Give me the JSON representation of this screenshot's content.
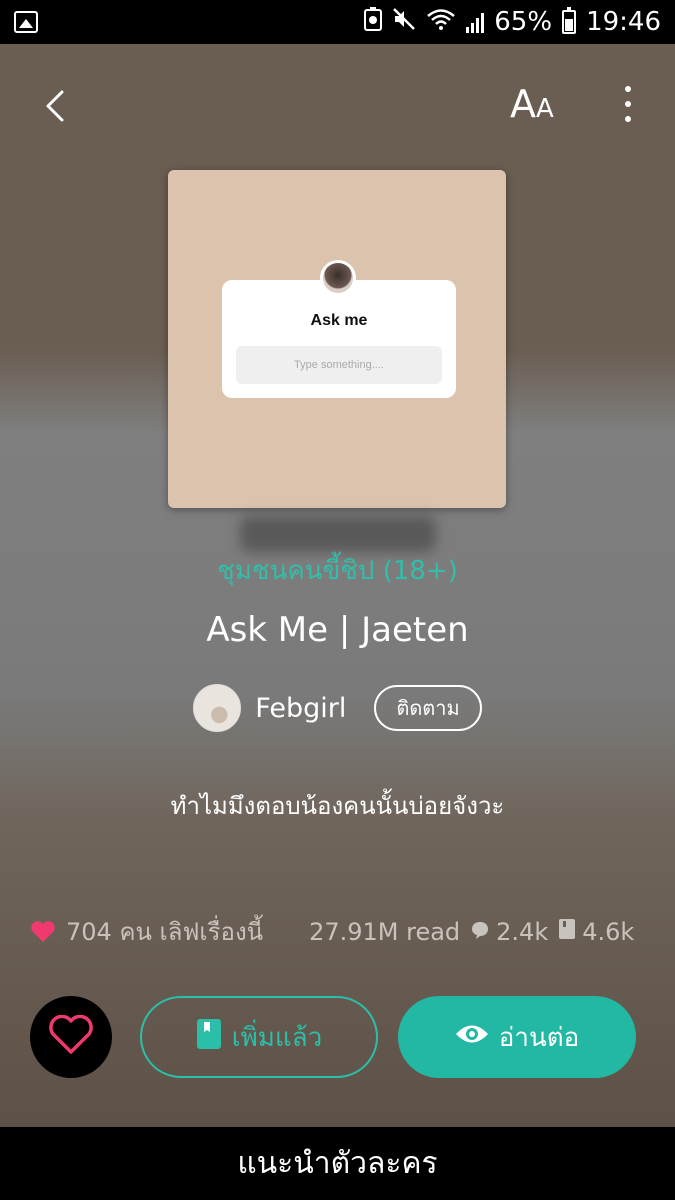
{
  "status_bar": {
    "battery_percent": "65%",
    "time": "19:46"
  },
  "toolbar": {
    "font_label": "A",
    "font_label_small": "A"
  },
  "cover": {
    "card_title": "Ask me",
    "card_input_placeholder": "Type something...."
  },
  "story": {
    "category": "ชุมชนคนขี้ชิป  (18+)",
    "title": "Ask Me | Jaeten",
    "author": "Febgirl",
    "follow_label": "ติดตาม",
    "synopsis": "ทำไมมึงตอบน้องคนนั้นบ่อยจังวะ"
  },
  "stats": {
    "likes_text": "704 คน เลิฟเรื่องนี้",
    "reads_text": "27.91M read",
    "comments": "2.4k",
    "chapters": "4.6k"
  },
  "actions": {
    "added_label": "เพิ่มแล้ว",
    "read_label": "อ่านต่อ"
  },
  "bottom": {
    "label": "แนะนำตัวละคร"
  },
  "colors": {
    "accent": "#22b8a3",
    "heart": "#f03a6f"
  }
}
